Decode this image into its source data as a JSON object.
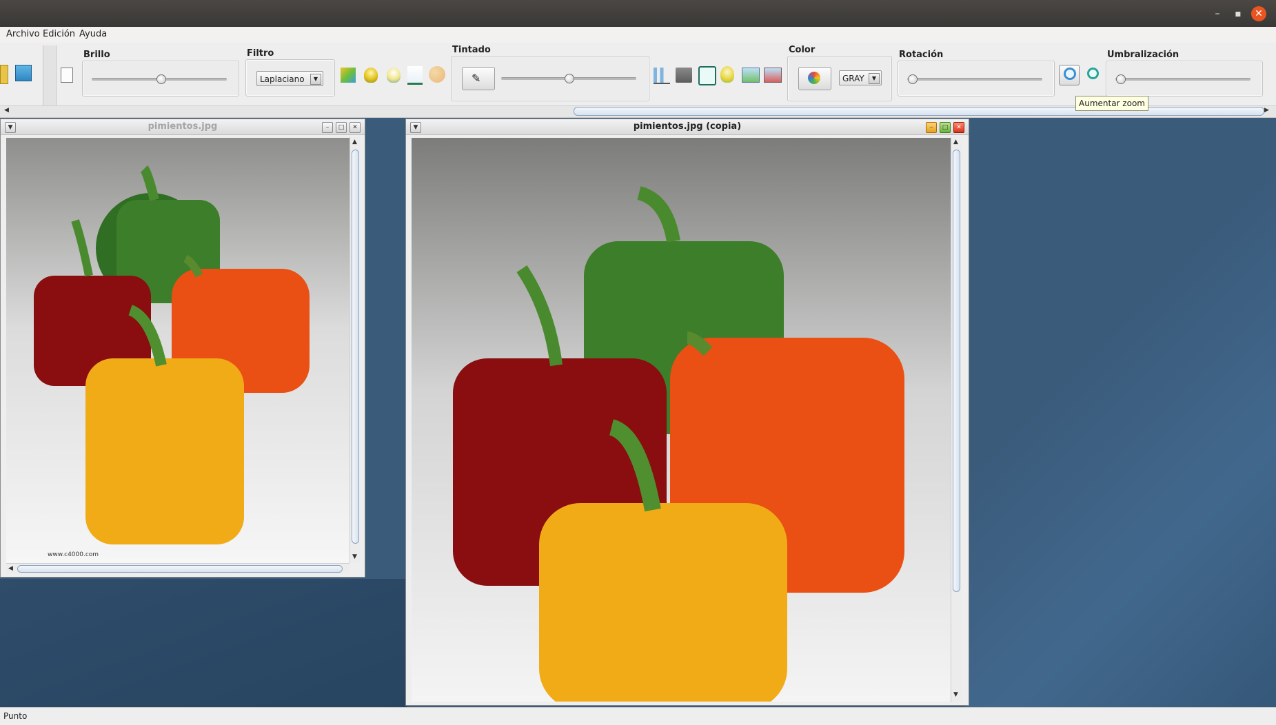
{
  "menu": {
    "items": [
      "Archivo",
      "Edición",
      "Ayuda"
    ]
  },
  "toolbar": {
    "brillo": {
      "label": "Brillo",
      "value_fraction": 0.5
    },
    "filtro": {
      "label": "Filtro",
      "selected": "Laplaciano"
    },
    "tintado": {
      "label": "Tintado",
      "value_fraction": 0.5
    },
    "color": {
      "label": "Color",
      "selected": "GRAY"
    },
    "rotacion": {
      "label": "Rotación",
      "value_fraction": 0.0
    },
    "umbralizacion": {
      "label": "Umbralización",
      "value_fraction": 0.0
    }
  },
  "tooltip": {
    "text": "Aumentar zoom"
  },
  "windows": {
    "original": {
      "title": "pimientos.jpg",
      "watermark": "www.c4000.com"
    },
    "copy": {
      "title": "pimientos.jpg (copia)"
    }
  },
  "status": {
    "text": "Punto"
  },
  "colors": {
    "accent_close": "#e95420",
    "desktop": "#3b5b7b"
  }
}
